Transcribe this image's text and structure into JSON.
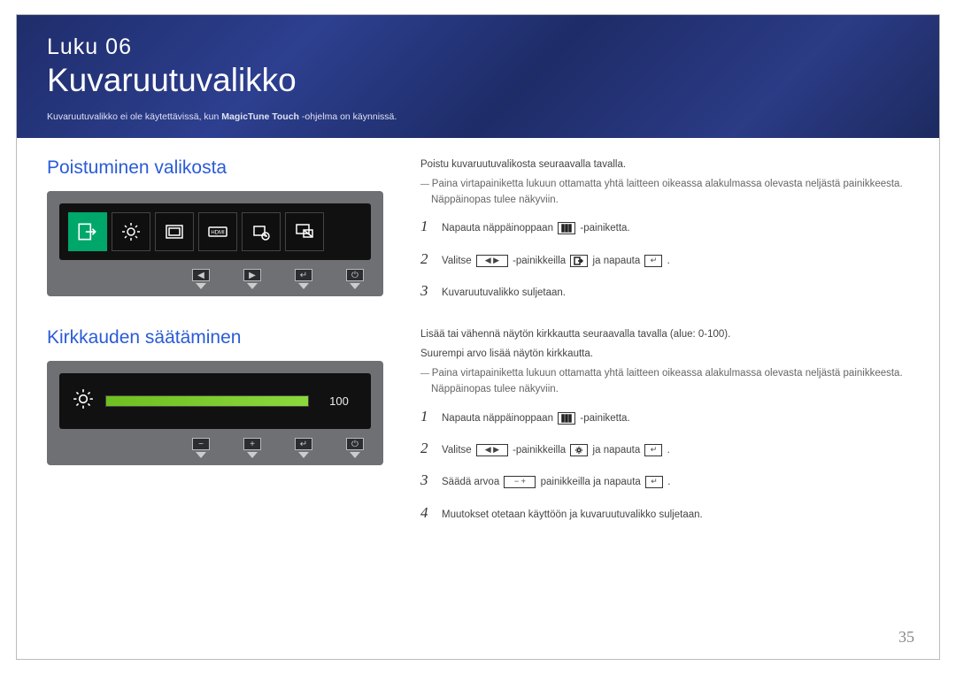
{
  "chapter": {
    "label": "Luku",
    "number": "06",
    "title": "Kuvaruutuvalikko",
    "note_prefix": "Kuvaruutuvalikko ei ole käytettävissä, kun ",
    "note_bold": "MagicTune Touch",
    "note_suffix": " -ohjelma on käynnissä."
  },
  "section1": {
    "title": "Poistuminen valikosta",
    "intro": "Poistu kuvaruutuvalikosta seuraavalla tavalla.",
    "note": "Paina virtapainiketta lukuun ottamatta yhtä laitteen oikeassa alakulmassa olevasta neljästä painikkeesta. Näppäinopas tulee näkyviin.",
    "steps": [
      {
        "pre": "Napauta näppäinoppaan ",
        "post": "-painiketta."
      },
      {
        "pre": "Valitse ",
        "mid": "-painikkeilla ",
        "post": " ja napauta "
      },
      {
        "text": "Kuvaruutuvalikko suljetaan."
      }
    ]
  },
  "section2": {
    "title": "Kirkkauden säätäminen",
    "intro1": "Lisää tai vähennä näytön kirkkautta seuraavalla tavalla (alue: 0-100).",
    "intro2": "Suurempi arvo lisää näytön kirkkautta.",
    "note": "Paina virtapainiketta lukuun ottamatta yhtä laitteen oikeassa alakulmassa olevasta neljästä painikkeesta. Näppäinopas tulee näkyviin.",
    "steps": [
      {
        "pre": "Napauta näppäinoppaan ",
        "post": "-painiketta."
      },
      {
        "pre": "Valitse ",
        "mid": "-painikkeilla ",
        "post": " ja napauta "
      },
      {
        "pre": "Säädä arvoa ",
        "post": " painikkeilla ja napauta "
      },
      {
        "text": "Muutokset otetaan käyttöön ja kuvaruutuvalikko suljetaan."
      }
    ]
  },
  "osd": {
    "brightness_value": "100"
  },
  "page_number": "35",
  "punct": {
    "period": "."
  }
}
